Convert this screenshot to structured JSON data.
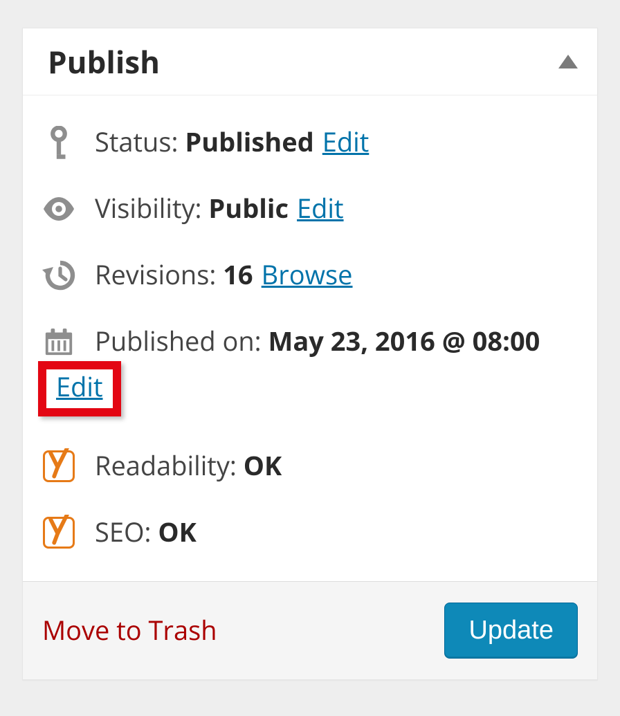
{
  "panel": {
    "title": "Publish"
  },
  "status": {
    "label": "Status:",
    "value": "Published",
    "edit": "Edit"
  },
  "visibility": {
    "label": "Visibility:",
    "value": "Public",
    "edit": "Edit"
  },
  "revisions": {
    "label": "Revisions:",
    "count": "16",
    "browse": "Browse"
  },
  "published": {
    "label": "Published on:",
    "value": "May 23, 2016 @ 08:00",
    "edit": "Edit"
  },
  "readability": {
    "label": "Readability:",
    "value": "OK"
  },
  "seo": {
    "label": "SEO:",
    "value": "OK"
  },
  "footer": {
    "trash": "Move to Trash",
    "update": "Update"
  }
}
